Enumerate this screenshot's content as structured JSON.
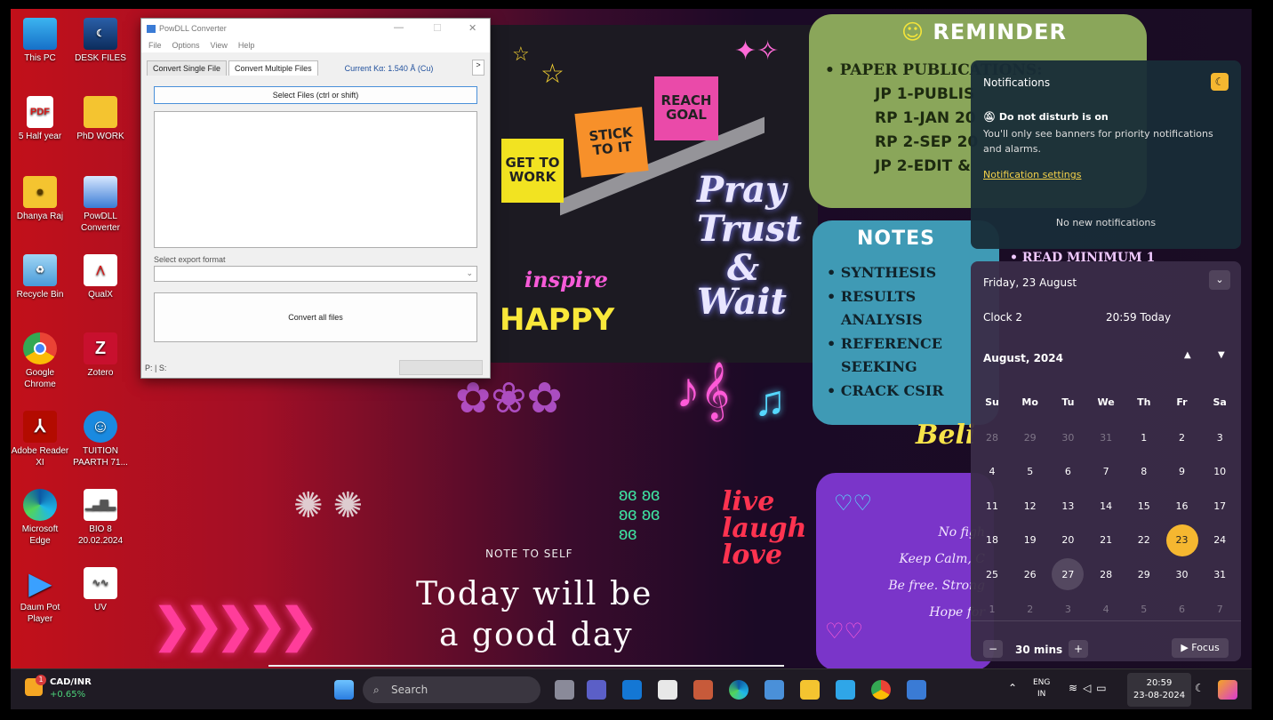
{
  "desktop_icons": [
    {
      "label": "This PC",
      "icon": "monitor-icon"
    },
    {
      "label": "DESK FILES",
      "icon": "folder-image-icon"
    },
    {
      "label": "5 Half year",
      "icon": "pdf-icon",
      "badge": "PDF"
    },
    {
      "label": "PhD WORK",
      "icon": "folder-shortcut-icon"
    },
    {
      "label": "Dhanya Raj",
      "icon": "user-folder-icon"
    },
    {
      "label": "PowDLL Converter",
      "icon": "powdll-icon"
    },
    {
      "label": "Recycle Bin",
      "icon": "recycle-bin-icon"
    },
    {
      "label": "QualX",
      "icon": "qualx-icon"
    },
    {
      "label": "Google Chrome",
      "icon": "chrome-icon"
    },
    {
      "label": "Zotero",
      "icon": "zotero-icon",
      "badge": "Z"
    },
    {
      "label": "Adobe Reader XI",
      "icon": "adobe-reader-icon"
    },
    {
      "label": "TUITION PAARTH 71...",
      "icon": "tuition-icon"
    },
    {
      "label": "Microsoft Edge",
      "icon": "edge-icon"
    },
    {
      "label": "BIO 8 20.02.2024",
      "icon": "chart-file-icon"
    },
    {
      "label": "Daum Pot Player",
      "icon": "potplayer-icon"
    },
    {
      "label": "UV",
      "icon": "chart-file-icon"
    }
  ],
  "app": {
    "title": "PowDLL Converter",
    "menu": [
      "File",
      "Options",
      "View",
      "Help"
    ],
    "tabs": [
      "Convert Single File",
      "Convert Multiple Files"
    ],
    "current_kα": "Current Kα: 1.540 Å (Cu)",
    "tab_arrow": ">",
    "select_files": "Select Files (ctrl or shift)",
    "export_label": "Select export format",
    "convert_all": "Convert all files",
    "status": "P: | S:"
  },
  "wallpaper": {
    "sticky_get": "GET TO WORK",
    "sticky_stick": "STICK TO IT",
    "sticky_reach": "REACH GOAL",
    "inspire": "inspire",
    "happy": "HAPPY",
    "pray": "Pray",
    "trust": "Trust",
    "amp": "&",
    "wait": "Wait",
    "reminder_title": "REMINDER",
    "reminder_items": [
      "• PAPER PUBLICATIONS:",
      "JP 1-PUBLIS",
      "RP 1-JAN 20",
      "RP 2-SEP 20",
      "JP 2-EDIT &"
    ],
    "notes_title": "NOTES",
    "notes_items": [
      "• SYNTHESIS",
      "• RESULTS",
      "ANALYSIS",
      "• REFERENCE",
      "SEEKING",
      "• CRACK CSIR"
    ],
    "read_min": "• READ MINIMUM 1",
    "purple_lines": [
      "No figh",
      "Keep Calm, C",
      "Be free. Strong",
      "Hope for"
    ],
    "beli": "Beli",
    "live_laugh_love": [
      "live",
      "laugh",
      "love"
    ],
    "note_to_self": "NOTE TO SELF",
    "today_1": "Today will be",
    "today_2": "a good day"
  },
  "notifications": {
    "title": "Notifications",
    "dnd_title": "Do not disturb is on",
    "dnd_text": "You'll only see banners for priority notifications and alarms.",
    "settings_link": "Notification settings",
    "empty": "No new notifications"
  },
  "calendar": {
    "date_header": "Friday, 23 August",
    "clock_label": "Clock 2",
    "clock_time": "20:59 Today",
    "month": "August, 2024",
    "weekdays": [
      "Su",
      "Mo",
      "Tu",
      "We",
      "Th",
      "Fr",
      "Sa"
    ],
    "days": [
      [
        "28",
        "29",
        "30",
        "31",
        "1",
        "2",
        "3"
      ],
      [
        "4",
        "5",
        "6",
        "7",
        "8",
        "9",
        "10"
      ],
      [
        "11",
        "12",
        "13",
        "14",
        "15",
        "16",
        "17"
      ],
      [
        "18",
        "19",
        "20",
        "21",
        "22",
        "23",
        "24"
      ],
      [
        "25",
        "26",
        "27",
        "28",
        "29",
        "30",
        "31"
      ],
      [
        "1",
        "2",
        "3",
        "4",
        "5",
        "6",
        "7"
      ]
    ],
    "today": "23",
    "hovered": "27",
    "focus_minus": "−",
    "focus_mins": "30 mins",
    "focus_plus": "+",
    "focus_button": "▶ Focus",
    "accent": "#f5b730"
  },
  "taskbar": {
    "widget_name": "CAD/INR",
    "widget_change": "+0.65%",
    "widget_badge": "1",
    "search_placeholder": "Search",
    "lang_1": "ENG",
    "lang_2": "IN",
    "time": "20:59",
    "date": "23-08-2024"
  }
}
